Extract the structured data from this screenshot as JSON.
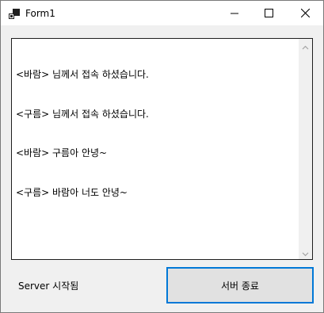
{
  "window": {
    "title": "Form1",
    "icon": "form-window-icon",
    "controls": [
      "minimize-icon",
      "maximize-icon",
      "close-icon"
    ]
  },
  "chat": {
    "lines": [
      "<바람> 님께서 접속 하셨습니다.",
      "<구름> 님께서 접속 하셨습니다.",
      "<바람> 구름아 안녕~",
      "<구름> 바람아 너도 안녕~"
    ]
  },
  "status": {
    "text": "Server 시작됨"
  },
  "stop_button": {
    "label": "서버 종료",
    "focus_color": "#0078d7"
  }
}
